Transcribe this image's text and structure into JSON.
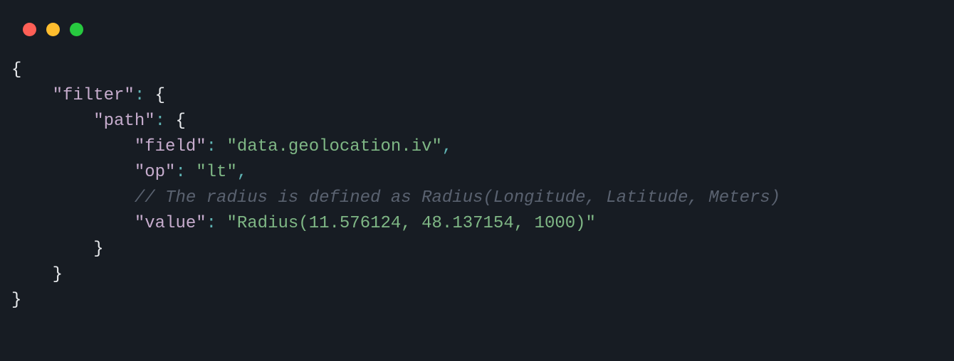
{
  "windowControls": {
    "red": "#ff5f56",
    "yellow": "#ffbd2e",
    "green": "#27c93f"
  },
  "code": {
    "line1_brace": "{",
    "line2_indent": "    ",
    "line2_key": "\"filter\"",
    "line2_colon": ": ",
    "line2_brace": "{",
    "line3_indent": "        ",
    "line3_key": "\"path\"",
    "line3_colon": ": ",
    "line3_brace": "{",
    "line4_indent": "            ",
    "line4_key": "\"field\"",
    "line4_colon": ": ",
    "line4_value": "\"data.geolocation.iv\"",
    "line4_comma": ",",
    "line5_indent": "            ",
    "line5_key": "\"op\"",
    "line5_colon": ": ",
    "line5_value": "\"lt\"",
    "line5_comma": ",",
    "line6_indent": "            ",
    "line6_comment": "// The radius is defined as Radius(Longitude, Latitude, Meters)",
    "line7_indent": "            ",
    "line7_key": "\"value\"",
    "line7_colon": ": ",
    "line7_value": "\"Radius(11.576124, 48.137154, 1000)\"",
    "line8_indent": "        ",
    "line8_brace": "}",
    "line9_indent": "    ",
    "line9_brace": "}",
    "line10_brace": "}"
  }
}
